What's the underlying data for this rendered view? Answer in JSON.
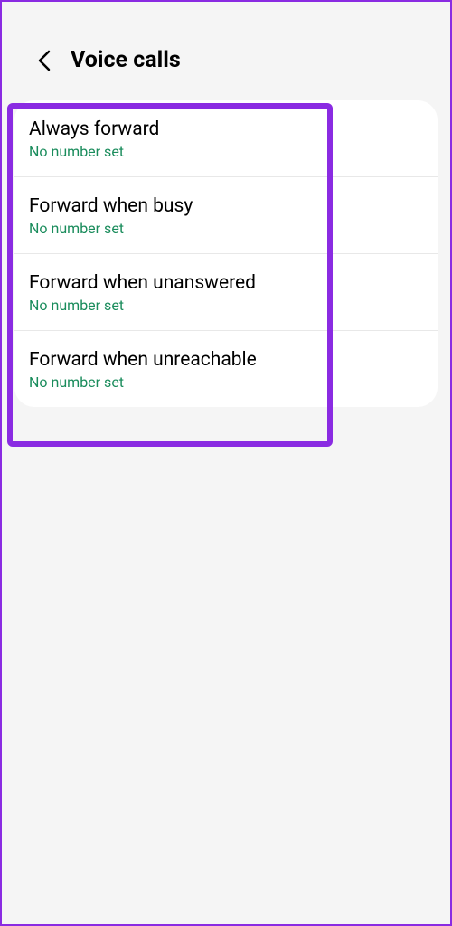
{
  "header": {
    "title": "Voice calls"
  },
  "items": [
    {
      "title": "Always forward",
      "subtitle": "No number set"
    },
    {
      "title": "Forward when busy",
      "subtitle": "No number set"
    },
    {
      "title": "Forward when unanswered",
      "subtitle": "No number set"
    },
    {
      "title": "Forward when unreachable",
      "subtitle": "No number set"
    }
  ]
}
